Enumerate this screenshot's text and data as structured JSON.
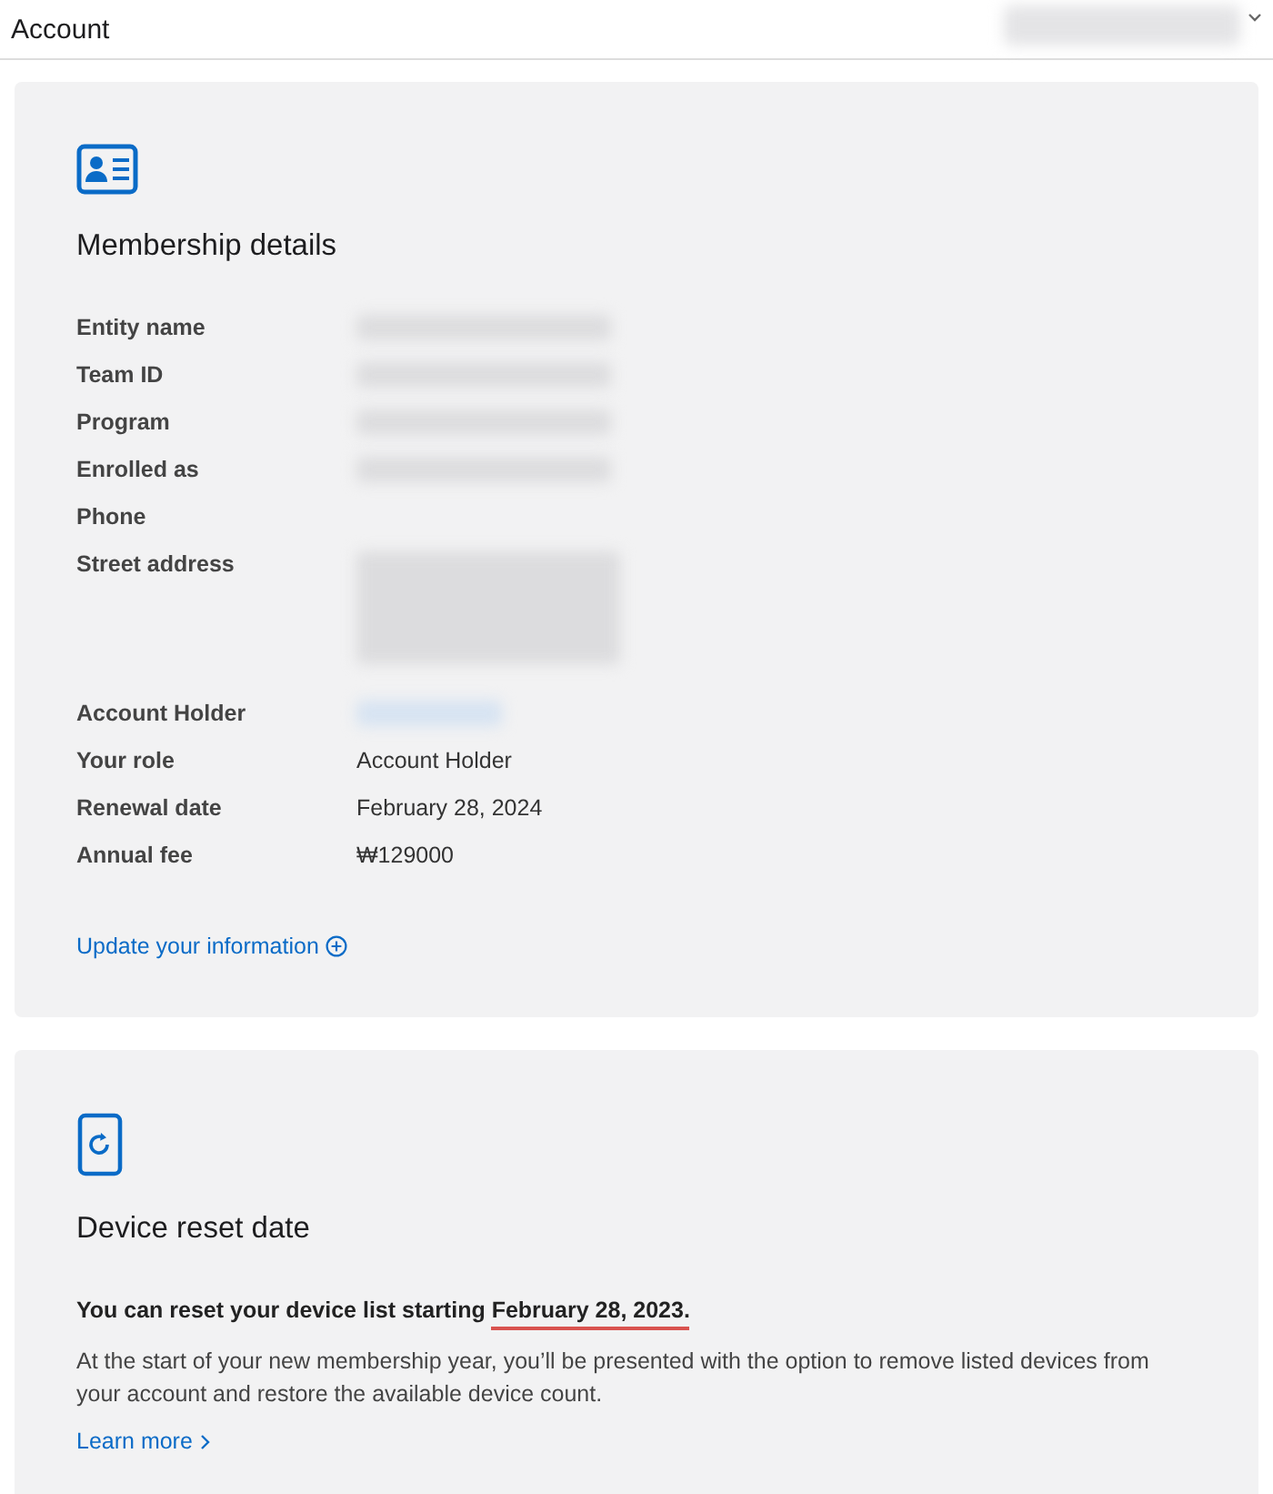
{
  "header": {
    "title": "Account",
    "account_menu": {
      "kind": "blurred"
    }
  },
  "membership": {
    "title": "Membership details",
    "rows": [
      {
        "label": "Entity name",
        "kind": "blurred"
      },
      {
        "label": "Team ID",
        "kind": "blurred"
      },
      {
        "label": "Program",
        "kind": "blurred"
      },
      {
        "label": "Enrolled as",
        "kind": "blurred"
      },
      {
        "label": "Phone",
        "kind": "empty"
      },
      {
        "label": "Street address",
        "kind": "blurred-block"
      },
      {
        "label": "Account Holder",
        "kind": "blurred-link"
      },
      {
        "label": "Your role",
        "kind": "text",
        "value": "Account Holder"
      },
      {
        "label": "Renewal date",
        "kind": "text",
        "value": "February 28, 2024"
      },
      {
        "label": "Annual fee",
        "kind": "text",
        "value": "₩129000"
      }
    ],
    "link": "Update your information"
  },
  "device_reset": {
    "title": "Device reset date",
    "notice": {
      "text": "You can reset your device list starting ",
      "date": "February 28, 2023.",
      "underlined": true
    },
    "description": "At the start of your new membership year, you’ll be presented with the option to remove listed devices from your account and restore the available device count.",
    "link": "Learn more"
  }
}
